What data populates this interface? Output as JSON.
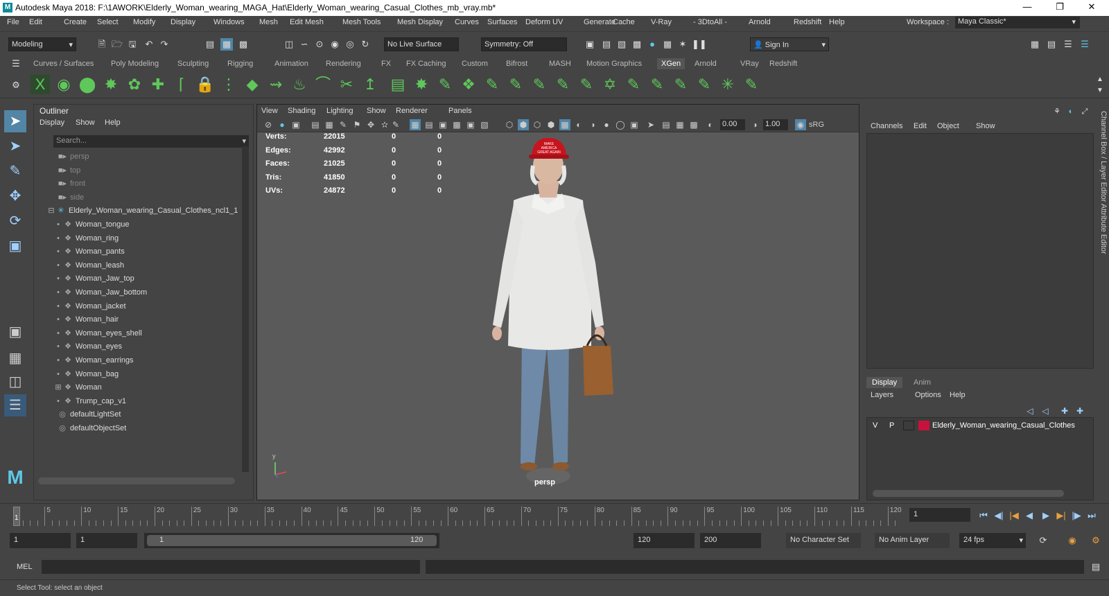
{
  "window": {
    "title": "Autodesk Maya 2018: F:\\1AWORK\\Elderly_Woman_wearing_MAGA_Hat\\Elderly_Woman_wearing_Casual_Clothes_mb_vray.mb*"
  },
  "menu": [
    "File",
    "Edit",
    "Create",
    "Select",
    "Modify",
    "Display",
    "Windows",
    "Mesh",
    "Edit Mesh",
    "Mesh Tools",
    "Mesh Display",
    "Curves",
    "Surfaces",
    "Deform",
    "UV",
    "Generate",
    "Cache",
    "V-Ray",
    "- 3DtoAll -",
    "Arnold",
    "Redshift",
    "Help"
  ],
  "workspace": {
    "label": "Workspace :",
    "value": "Maya Classic*"
  },
  "statusline": {
    "mode": "Modeling",
    "live_surface": "No Live Surface",
    "symmetry": "Symmetry: Off",
    "sign_in": "Sign In"
  },
  "shelf_tabs": [
    "Curves / Surfaces",
    "Poly Modeling",
    "Sculpting",
    "Rigging",
    "Animation",
    "Rendering",
    "FX",
    "FX Caching",
    "Custom",
    "Bifrost",
    "MASH",
    "Motion Graphics",
    "XGen",
    "Arnold",
    "VRay",
    "Redshift"
  ],
  "shelf_active": "XGen",
  "outliner": {
    "title": "Outliner",
    "menu": [
      "Display",
      "Show",
      "Help"
    ],
    "search_placeholder": "Search...",
    "items": [
      {
        "label": "persp",
        "dim": true,
        "indent": 1,
        "icon": "camera-icon"
      },
      {
        "label": "top",
        "dim": true,
        "indent": 1,
        "icon": "camera-icon"
      },
      {
        "label": "front",
        "dim": true,
        "indent": 1,
        "icon": "camera-icon"
      },
      {
        "label": "side",
        "dim": true,
        "indent": 1,
        "icon": "camera-icon"
      },
      {
        "label": "Elderly_Woman_wearing_Casual_Clothes_ncl1_1",
        "dim": false,
        "indent": 0,
        "icon": "group-icon"
      },
      {
        "label": "Woman_tongue",
        "dim": false,
        "indent": 2,
        "icon": "mesh-icon"
      },
      {
        "label": "Woman_ring",
        "dim": false,
        "indent": 2,
        "icon": "mesh-icon"
      },
      {
        "label": "Woman_pants",
        "dim": false,
        "indent": 2,
        "icon": "mesh-icon"
      },
      {
        "label": "Woman_leash",
        "dim": false,
        "indent": 2,
        "icon": "mesh-icon"
      },
      {
        "label": "Woman_Jaw_top",
        "dim": false,
        "indent": 2,
        "icon": "mesh-icon"
      },
      {
        "label": "Woman_Jaw_bottom",
        "dim": false,
        "indent": 2,
        "icon": "mesh-icon"
      },
      {
        "label": "Woman_jacket",
        "dim": false,
        "indent": 2,
        "icon": "mesh-icon"
      },
      {
        "label": "Woman_hair",
        "dim": false,
        "indent": 2,
        "icon": "mesh-icon"
      },
      {
        "label": "Woman_eyes_shell",
        "dim": false,
        "indent": 2,
        "icon": "mesh-icon"
      },
      {
        "label": "Woman_eyes",
        "dim": false,
        "indent": 2,
        "icon": "mesh-icon"
      },
      {
        "label": "Woman_earrings",
        "dim": false,
        "indent": 2,
        "icon": "mesh-icon"
      },
      {
        "label": "Woman_bag",
        "dim": false,
        "indent": 2,
        "icon": "mesh-icon"
      },
      {
        "label": "Woman",
        "dim": false,
        "indent": 2,
        "icon": "mesh-icon"
      },
      {
        "label": "Trump_cap_v1",
        "dim": false,
        "indent": 2,
        "icon": "mesh-icon"
      },
      {
        "label": "defaultLightSet",
        "dim": false,
        "indent": 1,
        "icon": "set-icon"
      },
      {
        "label": "defaultObjectSet",
        "dim": false,
        "indent": 1,
        "icon": "set-icon"
      }
    ]
  },
  "viewport": {
    "menu": [
      "View",
      "Shading",
      "Lighting",
      "Show",
      "Renderer",
      "Panels"
    ],
    "exposure": "0.00",
    "gamma": "1.00",
    "color_space": "sRG",
    "hud": [
      {
        "label": "Verts:",
        "v1": "22015",
        "v2": "0",
        "v3": "0"
      },
      {
        "label": "Edges:",
        "v1": "42992",
        "v2": "0",
        "v3": "0"
      },
      {
        "label": "Faces:",
        "v1": "21025",
        "v2": "0",
        "v3": "0"
      },
      {
        "label": "Tris:",
        "v1": "41850",
        "v2": "0",
        "v3": "0"
      },
      {
        "label": "UVs:",
        "v1": "24872",
        "v2": "0",
        "v3": "0"
      }
    ],
    "camera": "persp",
    "hat_text": "MAKE AMERICA GREAT AGAIN",
    "axis_y": "y"
  },
  "channelbox": {
    "menu": [
      "Channels",
      "Edit",
      "Object",
      "Show"
    ],
    "layer_tabs": [
      "Display",
      "Anim"
    ],
    "layer_menu": [
      "Layers",
      "Options",
      "Help"
    ],
    "layer": {
      "v": "V",
      "p": "P",
      "color": "#c8123c",
      "name": "Elderly_Woman_wearing_Casual_Clothes"
    },
    "side_tabs": "Channel Box / Layer Editor        Attribute Editor"
  },
  "timeline": {
    "ticks": [
      "5",
      "10",
      "15",
      "20",
      "25",
      "30",
      "35",
      "40",
      "45",
      "50",
      "55",
      "60",
      "65",
      "70",
      "75",
      "80",
      "85",
      "90",
      "95",
      "100",
      "105",
      "110",
      "115",
      "120"
    ],
    "current_frame": "1",
    "frame_field": "1"
  },
  "range": {
    "start": "1",
    "playback_start": "1",
    "slider_start": "1",
    "slider_end": "120",
    "playback_end": "120",
    "end": "200",
    "character_set": "No Character Set",
    "anim_layer": "No Anim Layer",
    "fps": "24 fps"
  },
  "mel": {
    "label": "MEL"
  },
  "help": "Select Tool: select an object"
}
